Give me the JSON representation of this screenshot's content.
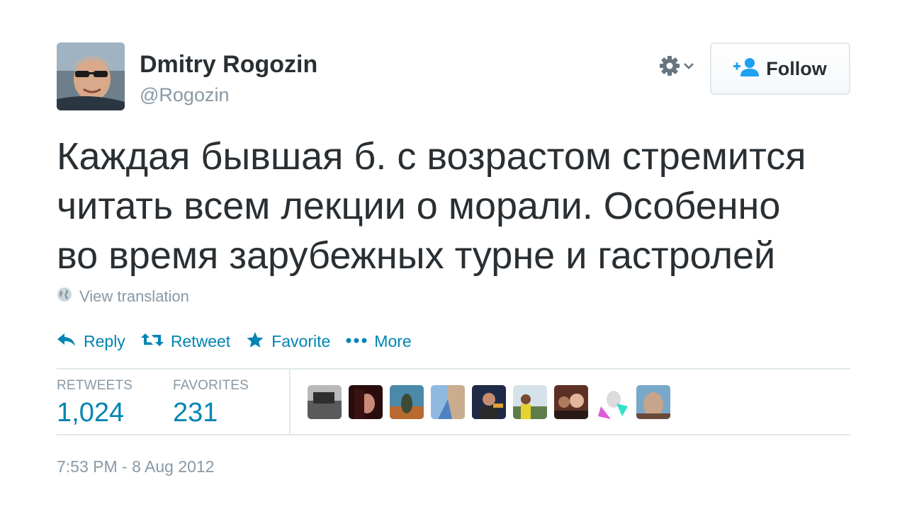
{
  "author": {
    "name": "Dmitry Rogozin",
    "handle": "@Rogozin"
  },
  "header": {
    "follow_label": "Follow",
    "settings_icon": "gear-icon"
  },
  "tweet": {
    "lines": [
      "Каждая бывшая б. с возрастом стремится",
      "читать всем лекции о морали. Особенно",
      "во время зарубежных турне и гастролей"
    ],
    "translation_label": "View translation"
  },
  "actions": {
    "reply": "Reply",
    "retweet": "Retweet",
    "favorite": "Favorite",
    "more": "More"
  },
  "stats": {
    "retweets_label": "RETWEETS",
    "retweets_value": "1,024",
    "favorites_label": "FAVORITES",
    "favorites_value": "231"
  },
  "timestamp": "7:53 PM - 8 Aug 2012",
  "colors": {
    "link": "#0084b4",
    "text": "#292f33",
    "muted": "#8899a6",
    "border": "#e1e8ed"
  }
}
